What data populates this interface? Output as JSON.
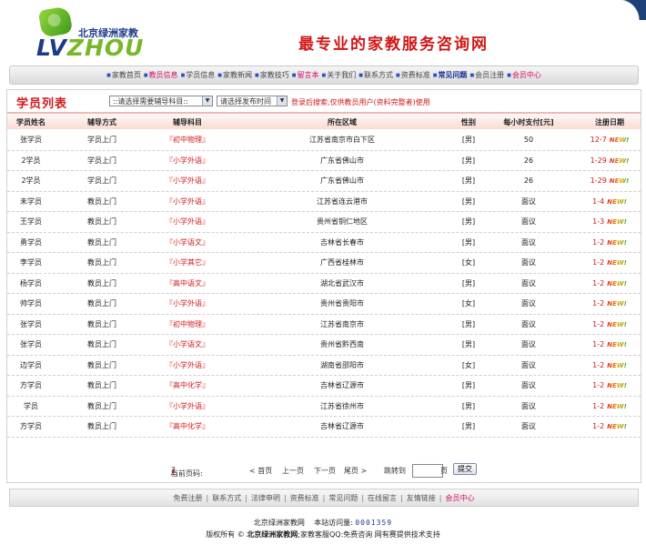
{
  "header": {
    "logo_cn": "北京绿洲家教",
    "logo_en_a": "LV",
    "logo_en_b": "ZHOU",
    "slogan": "最专业的家教服务咨询网"
  },
  "nav": [
    {
      "label": "家教首页",
      "style": ""
    },
    {
      "label": "教员信息",
      "style": "hl"
    },
    {
      "label": "学员信息",
      "style": ""
    },
    {
      "label": "家教新闻",
      "style": ""
    },
    {
      "label": "家教技巧",
      "style": ""
    },
    {
      "label": "留言本",
      "style": "hl"
    },
    {
      "label": "关于我们",
      "style": ""
    },
    {
      "label": "联系方式",
      "style": ""
    },
    {
      "label": "资费标准",
      "style": ""
    },
    {
      "label": "常见问题",
      "style": "blue"
    },
    {
      "label": "会员注册",
      "style": ""
    },
    {
      "label": "会员中心",
      "style": "hl"
    }
  ],
  "list": {
    "title": "学员列表",
    "subject_select": "::请选择需要辅导科目::",
    "time_select": "请选择发布时间",
    "search_note": "登录后搜索,仅供教员用户(资料完整者)使用"
  },
  "columns": [
    "学员姓名",
    "辅导方式",
    "辅导科目",
    "所在区域",
    "性别",
    "每小时支付[元]",
    "注册日期"
  ],
  "rows": [
    {
      "name": "张学员",
      "mode": "学员上门",
      "subject": "『初中物理』",
      "area": "江苏省南京市白下区",
      "sex": "[男]",
      "pay": "50",
      "date": "12-7"
    },
    {
      "name": "2学员",
      "mode": "学员上门",
      "subject": "『小学外语』",
      "area": "广东省佛山市",
      "sex": "[男]",
      "pay": "26",
      "date": "1-29"
    },
    {
      "name": "2学员",
      "mode": "学员上门",
      "subject": "『小学外语』",
      "area": "广东省佛山市",
      "sex": "[男]",
      "pay": "26",
      "date": "1-29"
    },
    {
      "name": "未学员",
      "mode": "教员上门",
      "subject": "『小学外语』",
      "area": "江苏省连云港市",
      "sex": "[男]",
      "pay": "面议",
      "date": "1-4"
    },
    {
      "name": "王学员",
      "mode": "教员上门",
      "subject": "『小学外语』",
      "area": "贵州省铜仁地区",
      "sex": "[男]",
      "pay": "面议",
      "date": "1-3"
    },
    {
      "name": "勇学员",
      "mode": "教员上门",
      "subject": "『小学语文』",
      "area": "吉林省长春市",
      "sex": "[男]",
      "pay": "面议",
      "date": "1-2"
    },
    {
      "name": "李学员",
      "mode": "教员上门",
      "subject": "『小学其它』",
      "area": "广西省桂林市",
      "sex": "[女]",
      "pay": "面议",
      "date": "1-2"
    },
    {
      "name": "杨学员",
      "mode": "教员上门",
      "subject": "『高中语文』",
      "area": "湖北省武汉市",
      "sex": "[男]",
      "pay": "面议",
      "date": "1-2"
    },
    {
      "name": "帅学员",
      "mode": "教员上门",
      "subject": "『小学外语』",
      "area": "贵州省贵阳市",
      "sex": "[女]",
      "pay": "面议",
      "date": "1-2"
    },
    {
      "name": "张学员",
      "mode": "教员上门",
      "subject": "『初中物理』",
      "area": "江苏省南京市",
      "sex": "[男]",
      "pay": "面议",
      "date": "1-2"
    },
    {
      "name": "张学员",
      "mode": "教员上门",
      "subject": "『小学语文』",
      "area": "贵州省黔西南",
      "sex": "[男]",
      "pay": "面议",
      "date": "1-2"
    },
    {
      "name": "边学员",
      "mode": "教员上门",
      "subject": "『小学外语』",
      "area": "湖南省邵阳市",
      "sex": "[女]",
      "pay": "面议",
      "date": "1-2"
    },
    {
      "name": "方学员",
      "mode": "教员上门",
      "subject": "『高中化学』",
      "area": "吉林省辽源市",
      "sex": "[男]",
      "pay": "面议",
      "date": "1-2"
    },
    {
      "name": "学员",
      "mode": "教员上门",
      "subject": "『小学外语』",
      "area": "江苏省徐州市",
      "sex": "[男]",
      "pay": "面议",
      "date": "1-2"
    },
    {
      "name": "方学员",
      "mode": "教员上门",
      "subject": "『高中化学』",
      "area": "吉林省辽源市",
      "sex": "[男]",
      "pay": "面议",
      "date": "1-2"
    }
  ],
  "new_badge": "NEW!",
  "pager": {
    "current_label": "当前页码:",
    "current": "1",
    "sep": "/",
    "total": "3",
    "first": "< 首页",
    "prev": "上一页",
    "next": "下一页",
    "last": "尾页 >",
    "goto": "跳转到",
    "page_unit": "页",
    "submit": "提交"
  },
  "footer_nav": [
    {
      "label": "免费注册",
      "style": ""
    },
    {
      "label": "联系方式",
      "style": ""
    },
    {
      "label": "法律申明",
      "style": ""
    },
    {
      "label": "资费标准",
      "style": ""
    },
    {
      "label": "常见问题",
      "style": ""
    },
    {
      "label": "在线留言",
      "style": ""
    },
    {
      "label": "友情链接",
      "style": ""
    },
    {
      "label": "会员中心",
      "style": "hl"
    }
  ],
  "footer_info": {
    "site": "北京绿洲家教网",
    "visits_label": "本站访问量:",
    "visits": "0001359",
    "rights_prefix": "版权所有 ©",
    "rights_name": "北京绿洲家教网",
    "rights_suffix": ";家教客服QQ:免费咨询 网有赛提供技术支持"
  }
}
